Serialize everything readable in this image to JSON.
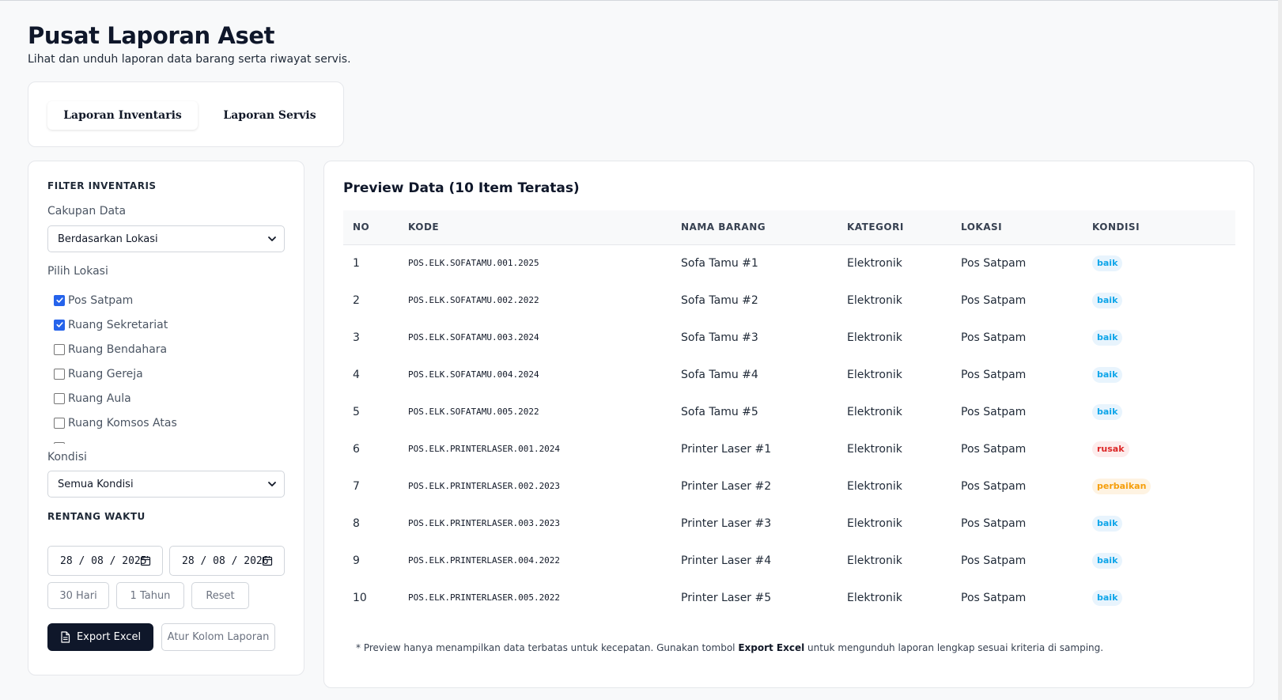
{
  "header": {
    "title": "Pusat Laporan Aset",
    "subtitle": "Lihat dan unduh laporan data barang serta riwayat servis."
  },
  "tabs": [
    {
      "label": "Laporan Inventaris",
      "active": true
    },
    {
      "label": "Laporan Servis",
      "active": false
    }
  ],
  "filter": {
    "section_title": "FILTER INVENTARIS",
    "scope_label": "Cakupan Data",
    "scope_value": "Berdasarkan Lokasi",
    "location_label": "Pilih Lokasi",
    "locations": [
      {
        "label": "Pos Satpam",
        "checked": true
      },
      {
        "label": "Ruang Sekretariat",
        "checked": true
      },
      {
        "label": "Ruang Bendahara",
        "checked": false
      },
      {
        "label": "Ruang Gereja",
        "checked": false
      },
      {
        "label": "Ruang Aula",
        "checked": false
      },
      {
        "label": "Ruang Komsos Atas",
        "checked": false
      }
    ],
    "condition_label": "Kondisi",
    "condition_value": "Semua Kondisi",
    "date_section_title": "RENTANG WAKTU",
    "date_start": "28 / 08 / 2025",
    "date_end": "28 / 08 / 2026",
    "quick_30": "30 Hari",
    "quick_year": "1 Tahun",
    "quick_reset": "Reset",
    "export_label": "Export Excel",
    "columns_label": "Atur Kolom Laporan"
  },
  "preview": {
    "title": "Preview Data (10 Item Teratas)",
    "columns": [
      "NO",
      "KODE",
      "NAMA BARANG",
      "KATEGORI",
      "LOKASI",
      "KONDISI"
    ],
    "rows": [
      {
        "no": "1",
        "kode": "POS.ELK.SOFATAMU.001.2025",
        "nama": "Sofa Tamu #1",
        "kategori": "Elektronik",
        "lokasi": "Pos Satpam",
        "kondisi": "baik"
      },
      {
        "no": "2",
        "kode": "POS.ELK.SOFATAMU.002.2022",
        "nama": "Sofa Tamu #2",
        "kategori": "Elektronik",
        "lokasi": "Pos Satpam",
        "kondisi": "baik"
      },
      {
        "no": "3",
        "kode": "POS.ELK.SOFATAMU.003.2024",
        "nama": "Sofa Tamu #3",
        "kategori": "Elektronik",
        "lokasi": "Pos Satpam",
        "kondisi": "baik"
      },
      {
        "no": "4",
        "kode": "POS.ELK.SOFATAMU.004.2024",
        "nama": "Sofa Tamu #4",
        "kategori": "Elektronik",
        "lokasi": "Pos Satpam",
        "kondisi": "baik"
      },
      {
        "no": "5",
        "kode": "POS.ELK.SOFATAMU.005.2022",
        "nama": "Sofa Tamu #5",
        "kategori": "Elektronik",
        "lokasi": "Pos Satpam",
        "kondisi": "baik"
      },
      {
        "no": "6",
        "kode": "POS.ELK.PRINTERLASER.001.2024",
        "nama": "Printer Laser #1",
        "kategori": "Elektronik",
        "lokasi": "Pos Satpam",
        "kondisi": "rusak"
      },
      {
        "no": "7",
        "kode": "POS.ELK.PRINTERLASER.002.2023",
        "nama": "Printer Laser #2",
        "kategori": "Elektronik",
        "lokasi": "Pos Satpam",
        "kondisi": "perbaikan"
      },
      {
        "no": "8",
        "kode": "POS.ELK.PRINTERLASER.003.2023",
        "nama": "Printer Laser #3",
        "kategori": "Elektronik",
        "lokasi": "Pos Satpam",
        "kondisi": "baik"
      },
      {
        "no": "9",
        "kode": "POS.ELK.PRINTERLASER.004.2022",
        "nama": "Printer Laser #4",
        "kategori": "Elektronik",
        "lokasi": "Pos Satpam",
        "kondisi": "baik"
      },
      {
        "no": "10",
        "kode": "POS.ELK.PRINTERLASER.005.2022",
        "nama": "Printer Laser #5",
        "kategori": "Elektronik",
        "lokasi": "Pos Satpam",
        "kondisi": "baik"
      }
    ],
    "note_prefix": "* Preview hanya menampilkan data terbatas untuk kecepatan. Gunakan tombol ",
    "note_bold": "Export Excel",
    "note_suffix": " untuk mengunduh laporan lengkap sesuai kriteria di samping."
  },
  "colors": {
    "primary_dark": "#0f172a",
    "checkbox": "#2563eb",
    "badge_baik": "#0ea5e9",
    "badge_rusak": "#dc2626",
    "badge_perbaikan": "#f59e0b"
  },
  "icons": {
    "dropdown": "chevron-down-icon",
    "calendar": "calendar-icon",
    "export": "file-icon",
    "check": "check-icon"
  }
}
